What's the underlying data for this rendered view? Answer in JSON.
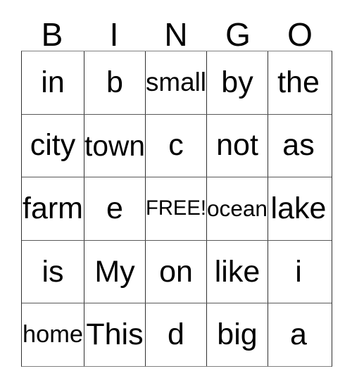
{
  "card": {
    "title": "BINGO",
    "columns": [
      "B",
      "I",
      "N",
      "G",
      "O"
    ],
    "free_space_label": "FREE!",
    "colors": {
      "background": "#ffffff",
      "text": "#000000",
      "grid_line": "#303030",
      "outer_border": "#808080"
    },
    "rows": [
      {
        "cells": [
          "in",
          "b",
          "small",
          "by",
          "the"
        ]
      },
      {
        "cells": [
          "city",
          "town",
          "c",
          "not",
          "as"
        ]
      },
      {
        "cells": [
          "farm",
          "e",
          "FREE!",
          "ocean",
          "lake"
        ]
      },
      {
        "cells": [
          "is",
          "My",
          "on",
          "like",
          "i"
        ]
      },
      {
        "cells": [
          "home",
          "This",
          "d",
          "big",
          "a"
        ]
      }
    ]
  }
}
